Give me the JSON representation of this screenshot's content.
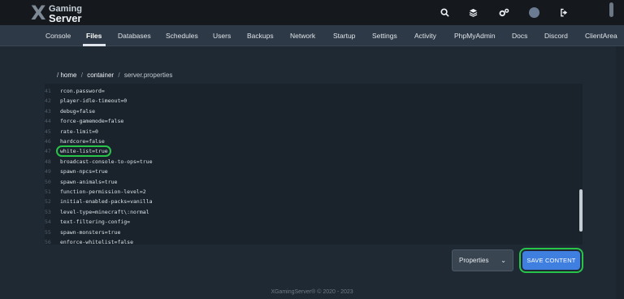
{
  "brand": {
    "logo_line1": "Gaming",
    "logo_line2": "Server",
    "logo_mark": "X"
  },
  "header_icons": [
    "search-icon",
    "layers-icon",
    "gears-icon",
    "avatar",
    "sign-out-icon"
  ],
  "nav": {
    "items": [
      "Console",
      "Files",
      "Databases",
      "Schedules",
      "Users",
      "Backups",
      "Network",
      "Startup",
      "Settings",
      "Activity",
      "PhpMyAdmin",
      "Docs",
      "Discord",
      "ClientArea"
    ],
    "active": "Files"
  },
  "breadcrumb": {
    "prefix": "/",
    "part1": "home",
    "sep1": "/",
    "part2": "container",
    "sep2": "/",
    "part3": "server.properties"
  },
  "editor": {
    "lines": [
      {
        "n": "41",
        "text": "rcon.password="
      },
      {
        "n": "42",
        "text": "player-idle-timeout=0"
      },
      {
        "n": "43",
        "text": "debug=false"
      },
      {
        "n": "44",
        "text": "force-gamemode=false"
      },
      {
        "n": "45",
        "text": "rate-limit=0"
      },
      {
        "n": "46",
        "text": "hardcore=false"
      },
      {
        "n": "47",
        "text": "white-list=true"
      },
      {
        "n": "48",
        "text": "broadcast-console-to-ops=true"
      },
      {
        "n": "49",
        "text": "spawn-npcs=true"
      },
      {
        "n": "50",
        "text": "spawn-animals=true"
      },
      {
        "n": "51",
        "text": "function-permission-level=2"
      },
      {
        "n": "52",
        "text": "initial-enabled-packs=vanilla"
      },
      {
        "n": "53",
        "text": "level-type=minecraft\\:normal"
      },
      {
        "n": "54",
        "text": "text-filtering-config="
      },
      {
        "n": "55",
        "text": "spawn-monsters=true"
      },
      {
        "n": "56",
        "text": "enforce-whitelist=false"
      }
    ],
    "highlighted_line": "47"
  },
  "controls": {
    "mode_select": "Properties",
    "save_label": "SAVE CONTENT"
  },
  "footer": {
    "text": "XGamingServer® © 2020 - 2023"
  },
  "colors": {
    "highlight": "#28c44a",
    "save_button": "#3f7fe0"
  }
}
